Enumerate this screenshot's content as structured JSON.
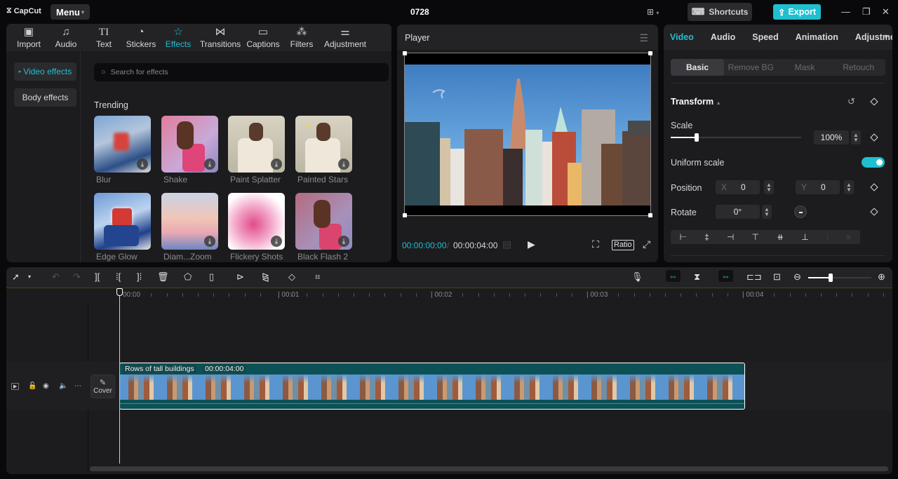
{
  "app": {
    "logo": "CapCut",
    "menu_label": "Menu",
    "project_title": "0728"
  },
  "titlebar": {
    "shortcuts_label": "Shortcuts",
    "export_label": "Export"
  },
  "media_toolbar": {
    "tabs": [
      {
        "label": "Import",
        "icon": "import-icon"
      },
      {
        "label": "Audio",
        "icon": "audio-icon"
      },
      {
        "label": "Text",
        "icon": "text-icon"
      },
      {
        "label": "Stickers",
        "icon": "sticker-icon"
      },
      {
        "label": "Effects",
        "icon": "effects-icon",
        "active": true
      },
      {
        "label": "Transitions",
        "icon": "transition-icon"
      },
      {
        "label": "Captions",
        "icon": "captions-icon"
      },
      {
        "label": "Filters",
        "icon": "filters-icon"
      },
      {
        "label": "Adjustment",
        "icon": "adjustment-icon"
      }
    ]
  },
  "effects": {
    "categories": [
      {
        "label": "Video effects",
        "active": true
      },
      {
        "label": "Body effects"
      }
    ],
    "search_placeholder": "Search for effects",
    "section_title": "Trending",
    "items": [
      {
        "label": "Blur"
      },
      {
        "label": "Shake"
      },
      {
        "label": "Paint Splatter"
      },
      {
        "label": "Painted Stars"
      },
      {
        "label": "Edge Glow"
      },
      {
        "label": "Diam...Zoom"
      },
      {
        "label": "Flickery Shots"
      },
      {
        "label": "Black Flash 2"
      }
    ]
  },
  "player": {
    "title": "Player",
    "current_time": "00:00:00:00",
    "separator": "/",
    "total_time": "00:00:04:00",
    "ratio_label": "Ratio"
  },
  "inspector": {
    "tabs": [
      {
        "label": "Video",
        "active": true
      },
      {
        "label": "Audio"
      },
      {
        "label": "Speed"
      },
      {
        "label": "Animation"
      },
      {
        "label": "Adjustme"
      }
    ],
    "subtabs": [
      {
        "label": "Basic",
        "active": true
      },
      {
        "label": "Remove BG"
      },
      {
        "label": "Mask"
      },
      {
        "label": "Retouch"
      }
    ],
    "transform_label": "Transform",
    "scale_label": "Scale",
    "scale_value": "100%",
    "scale_slider_fraction": 0.2,
    "uniform_scale_label": "Uniform scale",
    "uniform_scale_on": true,
    "position_label": "Position",
    "position_x_label": "X",
    "position_x": "0",
    "position_y_label": "Y",
    "position_y": "0",
    "rotate_label": "Rotate",
    "rotate_value": "0°"
  },
  "timeline": {
    "ruler_labels": [
      "00:00",
      "00:01",
      "00:02",
      "00:03",
      "00:04"
    ],
    "clip": {
      "name": "Rows of tall buildings",
      "duration": "00:00:04:00"
    },
    "cover_label": "Cover",
    "zoom_fraction": 0.35
  }
}
